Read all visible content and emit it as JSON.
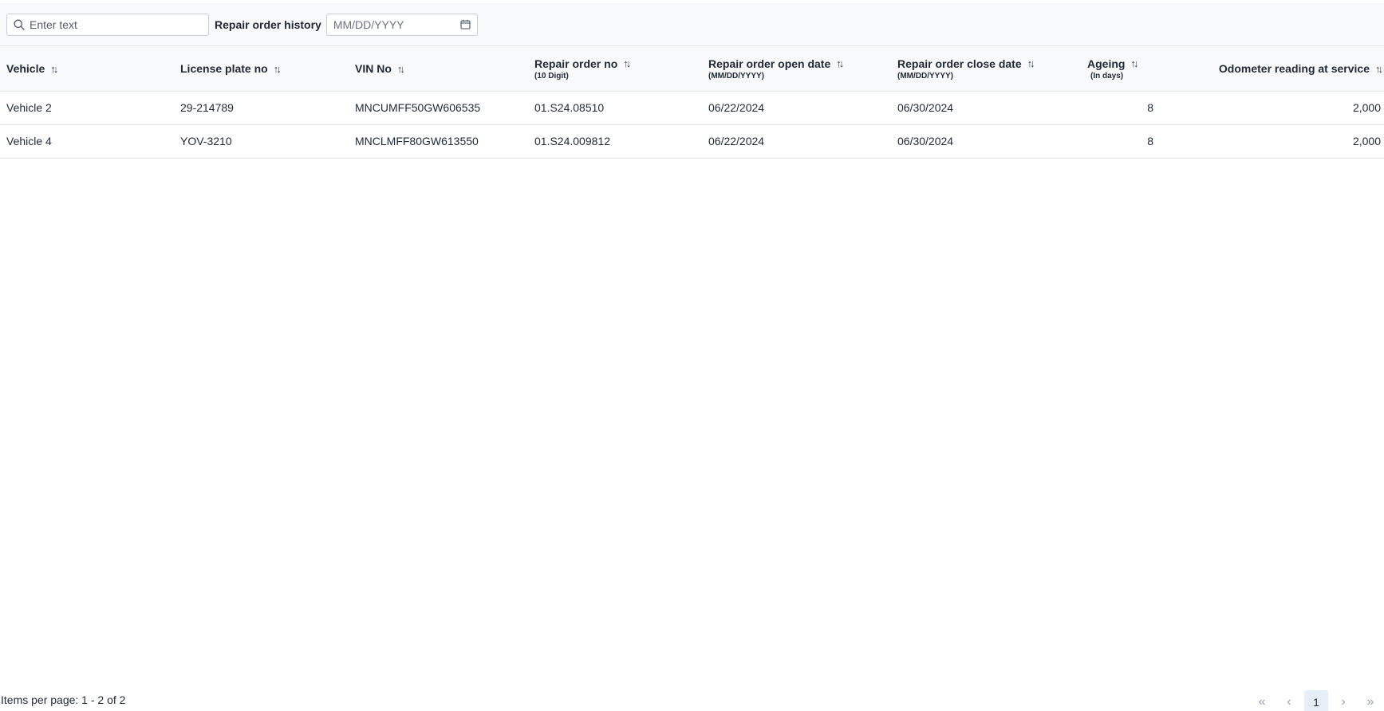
{
  "toolbar": {
    "search_placeholder": "Enter text",
    "history_label": "Repair order history",
    "date_placeholder": "MM/DD/YYYY"
  },
  "table": {
    "columns": [
      {
        "title": "Vehicle",
        "subtitle": ""
      },
      {
        "title": "License plate no",
        "subtitle": ""
      },
      {
        "title": "VIN No",
        "subtitle": ""
      },
      {
        "title": "Repair order no",
        "subtitle": "(10 Digit)"
      },
      {
        "title": "Repair order open date",
        "subtitle": "(MM/DD/YYYY)"
      },
      {
        "title": "Repair order close date",
        "subtitle": "(MM/DD/YYYY)"
      },
      {
        "title": "Ageing",
        "subtitle": "(In days)"
      },
      {
        "title": "Odometer reading at service",
        "subtitle": ""
      }
    ],
    "sort_glyph": "↑↓",
    "rows": [
      {
        "vehicle": "Vehicle 2",
        "plate": "29-214789",
        "vin": "MNCUMFF50GW606535",
        "ro_no": "01.S24.08510",
        "open_date": "06/22/2024",
        "close_date": "06/30/2024",
        "ageing": "8",
        "odometer": "2,000"
      },
      {
        "vehicle": "Vehicle 4",
        "plate": "YOV-3210",
        "vin": "MNCLMFF80GW613550",
        "ro_no": "01.S24.009812",
        "open_date": "06/22/2024",
        "close_date": "06/30/2024",
        "ageing": "8",
        "odometer": "2,000"
      }
    ]
  },
  "footer": {
    "items_info": "Items per page: 1 - 2 of 2",
    "pager": {
      "first": "«",
      "prev": "‹",
      "current_page": "1",
      "next": "›",
      "last": "»"
    }
  },
  "icons": {
    "search": "search-icon",
    "calendar": "calendar-icon",
    "sort": "sort-icon"
  }
}
